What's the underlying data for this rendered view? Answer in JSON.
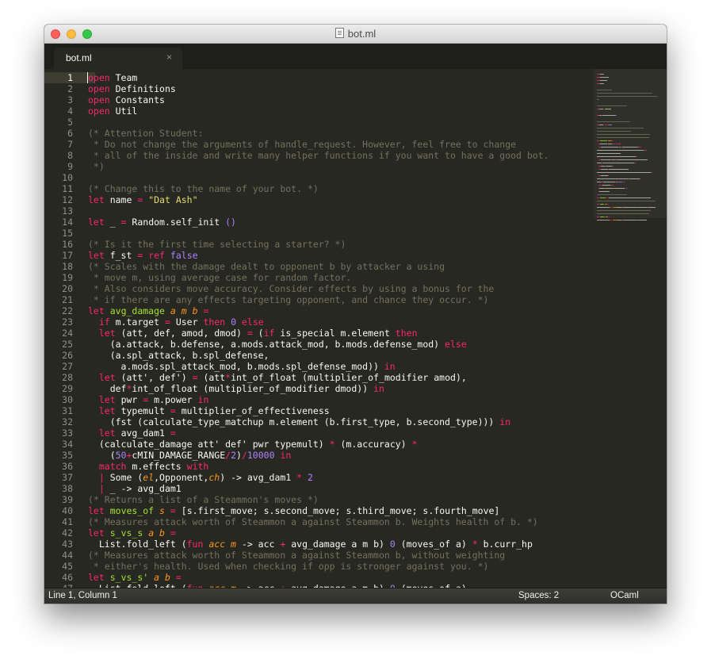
{
  "window": {
    "title": "bot.ml",
    "buttons": [
      "close",
      "minimize",
      "zoom"
    ]
  },
  "tab": {
    "label": "bot.ml",
    "close_glyph": "×"
  },
  "editor": {
    "current_line": 1,
    "lines": [
      [
        [
          "kw",
          "open"
        ],
        [
          "tx",
          " Team"
        ]
      ],
      [
        [
          "kw",
          "open"
        ],
        [
          "tx",
          " Definitions"
        ]
      ],
      [
        [
          "kw",
          "open"
        ],
        [
          "tx",
          " Constants"
        ]
      ],
      [
        [
          "kw",
          "open"
        ],
        [
          "tx",
          " Util"
        ]
      ],
      [],
      [
        [
          "cm",
          "(* Attention Student:"
        ]
      ],
      [
        [
          "cm",
          " * Do not change the arguments of handle_request. However, feel free to change"
        ]
      ],
      [
        [
          "cm",
          " * all of the inside and write many helper functions if you want to have a good bot."
        ]
      ],
      [
        [
          "cm",
          " *)"
        ]
      ],
      [],
      [
        [
          "cm",
          "(* Change this to the name of your bot. *)"
        ]
      ],
      [
        [
          "kw",
          "let"
        ],
        [
          "tx",
          " name "
        ],
        [
          "op",
          "="
        ],
        [
          "tx",
          " "
        ],
        [
          "str",
          "\"Dat Ash\""
        ]
      ],
      [],
      [
        [
          "kw",
          "let"
        ],
        [
          "tx",
          " _ "
        ],
        [
          "op",
          "="
        ],
        [
          "tx",
          " Random.self_init "
        ],
        [
          "num",
          "()"
        ]
      ],
      [],
      [
        [
          "cm",
          "(* Is it the first time selecting a starter? *)"
        ]
      ],
      [
        [
          "kw",
          "let"
        ],
        [
          "tx",
          " f_st "
        ],
        [
          "op",
          "="
        ],
        [
          "tx",
          " "
        ],
        [
          "kw",
          "ref"
        ],
        [
          "tx",
          " "
        ],
        [
          "num",
          "false"
        ]
      ],
      [
        [
          "cm",
          "(* Scales with the damage dealt to opponent b by attacker a using"
        ]
      ],
      [
        [
          "cm",
          " * move m, using average case for random factor."
        ]
      ],
      [
        [
          "cm",
          " * Also considers move accuracy. Consider effects by using a bonus for the"
        ]
      ],
      [
        [
          "cm",
          " * if there are any effects targeting opponent, and chance they occur. *)"
        ]
      ],
      [
        [
          "kw",
          "let"
        ],
        [
          "tx",
          " "
        ],
        [
          "fn",
          "avg_damage"
        ],
        [
          "tx",
          " "
        ],
        [
          "arg",
          "a m b"
        ],
        [
          "tx",
          " "
        ],
        [
          "op",
          "="
        ]
      ],
      [
        [
          "tx",
          "  "
        ],
        [
          "kw",
          "if"
        ],
        [
          "tx",
          " m.target "
        ],
        [
          "op",
          "="
        ],
        [
          "tx",
          " User "
        ],
        [
          "kw",
          "then"
        ],
        [
          "tx",
          " "
        ],
        [
          "num",
          "0"
        ],
        [
          "tx",
          " "
        ],
        [
          "kw",
          "else"
        ]
      ],
      [
        [
          "tx",
          "  "
        ],
        [
          "kw",
          "let"
        ],
        [
          "tx",
          " (att, def, amod, dmod) "
        ],
        [
          "op",
          "="
        ],
        [
          "tx",
          " ("
        ],
        [
          "kw",
          "if"
        ],
        [
          "tx",
          " is_special m.element "
        ],
        [
          "kw",
          "then"
        ]
      ],
      [
        [
          "tx",
          "    (a.attack, b.defense, a.mods.attack_mod, b.mods.defense_mod) "
        ],
        [
          "kw",
          "else"
        ]
      ],
      [
        [
          "tx",
          "    (a.spl_attack, b.spl_defense,"
        ]
      ],
      [
        [
          "tx",
          "      a.mods.spl_attack_mod, b.mods.spl_defense_mod)) "
        ],
        [
          "kw",
          "in"
        ]
      ],
      [
        [
          "tx",
          "  "
        ],
        [
          "kw",
          "let"
        ],
        [
          "tx",
          " (att', def') "
        ],
        [
          "op",
          "="
        ],
        [
          "tx",
          " (att"
        ],
        [
          "op",
          "*"
        ],
        [
          "tx",
          "int_of_float (multiplier_of_modifier amod),"
        ]
      ],
      [
        [
          "tx",
          "    def"
        ],
        [
          "op",
          "*"
        ],
        [
          "tx",
          "int_of_float (multiplier_of_modifier dmod)) "
        ],
        [
          "kw",
          "in"
        ]
      ],
      [
        [
          "tx",
          "  "
        ],
        [
          "kw",
          "let"
        ],
        [
          "tx",
          " pwr "
        ],
        [
          "op",
          "="
        ],
        [
          "tx",
          " m.power "
        ],
        [
          "kw",
          "in"
        ]
      ],
      [
        [
          "tx",
          "  "
        ],
        [
          "kw",
          "let"
        ],
        [
          "tx",
          " typemult "
        ],
        [
          "op",
          "="
        ],
        [
          "tx",
          " multiplier_of_effectiveness"
        ]
      ],
      [
        [
          "tx",
          "    (fst (calculate_type_matchup m.element (b.first_type, b.second_type))) "
        ],
        [
          "kw",
          "in"
        ]
      ],
      [
        [
          "tx",
          "  "
        ],
        [
          "kw",
          "let"
        ],
        [
          "tx",
          " avg_dam1 "
        ],
        [
          "op",
          "="
        ]
      ],
      [
        [
          "tx",
          "  (calculate_damage att' def' pwr typemult) "
        ],
        [
          "op",
          "*"
        ],
        [
          "tx",
          " (m.accuracy) "
        ],
        [
          "op",
          "*"
        ]
      ],
      [
        [
          "tx",
          "    ("
        ],
        [
          "num",
          "50"
        ],
        [
          "op",
          "+"
        ],
        [
          "tx",
          "cMIN_DAMAGE_RANGE"
        ],
        [
          "op",
          "/"
        ],
        [
          "num",
          "2"
        ],
        [
          "tx",
          ")"
        ],
        [
          "op",
          "/"
        ],
        [
          "num",
          "10000"
        ],
        [
          "tx",
          " "
        ],
        [
          "kw",
          "in"
        ]
      ],
      [
        [
          "tx",
          "  "
        ],
        [
          "kw",
          "match"
        ],
        [
          "tx",
          " m.effects "
        ],
        [
          "kw",
          "with"
        ]
      ],
      [
        [
          "tx",
          "  "
        ],
        [
          "op",
          "|"
        ],
        [
          "tx",
          " Some ("
        ],
        [
          "arg",
          "el"
        ],
        [
          "tx",
          ",Opponent,"
        ],
        [
          "arg",
          "ch"
        ],
        [
          "tx",
          ") -> avg_dam1 "
        ],
        [
          "op",
          "*"
        ],
        [
          "tx",
          " "
        ],
        [
          "num",
          "2"
        ]
      ],
      [
        [
          "tx",
          "  "
        ],
        [
          "op",
          "|"
        ],
        [
          "tx",
          " _ -> avg_dam1"
        ]
      ],
      [
        [
          "cm",
          "(* Returns a list of a Steammon's moves *)"
        ]
      ],
      [
        [
          "kw",
          "let"
        ],
        [
          "tx",
          " "
        ],
        [
          "fn",
          "moves_of"
        ],
        [
          "tx",
          " "
        ],
        [
          "arg",
          "s"
        ],
        [
          "tx",
          " "
        ],
        [
          "op",
          "="
        ],
        [
          "tx",
          " [s.first_move; s.second_move; s.third_move; s.fourth_move]"
        ]
      ],
      [
        [
          "cm",
          "(* Measures attack worth of Steammon a against Steammon b. Weights health of b. *)"
        ]
      ],
      [
        [
          "kw",
          "let"
        ],
        [
          "tx",
          " "
        ],
        [
          "fn",
          "s_vs_s"
        ],
        [
          "tx",
          " "
        ],
        [
          "arg",
          "a b"
        ],
        [
          "tx",
          " "
        ],
        [
          "op",
          "="
        ]
      ],
      [
        [
          "tx",
          "  List.fold_left ("
        ],
        [
          "kw",
          "fun"
        ],
        [
          "tx",
          " "
        ],
        [
          "arg",
          "acc m"
        ],
        [
          "tx",
          " -> acc "
        ],
        [
          "op",
          "+"
        ],
        [
          "tx",
          " avg_damage a m b) "
        ],
        [
          "num",
          "0"
        ],
        [
          "tx",
          " (moves_of a) "
        ],
        [
          "op",
          "*"
        ],
        [
          "tx",
          " b.curr_hp"
        ]
      ],
      [
        [
          "cm",
          "(* Measures attack worth of Steammon a against Steammon b, without weighting"
        ]
      ],
      [
        [
          "cm",
          " * either's health. Used when checking if opp is stronger against you. *)"
        ]
      ],
      [
        [
          "kw",
          "let"
        ],
        [
          "tx",
          " "
        ],
        [
          "fn",
          "s_vs_s'"
        ],
        [
          "tx",
          " "
        ],
        [
          "arg",
          "a b"
        ],
        [
          "tx",
          " "
        ],
        [
          "op",
          "="
        ]
      ],
      [
        [
          "tx",
          "  List.fold_left ("
        ],
        [
          "kw",
          "fun"
        ],
        [
          "tx",
          " "
        ],
        [
          "arg",
          "acc m"
        ],
        [
          "tx",
          " -> acc "
        ],
        [
          "op",
          "+"
        ],
        [
          "tx",
          " avg_damage a m b) "
        ],
        [
          "num",
          "0"
        ],
        [
          "tx",
          " (moves_of a)"
        ]
      ]
    ]
  },
  "status": {
    "position": "Line 1, Column 1",
    "indentation": "Spaces: 2",
    "syntax": "OCaml"
  },
  "colors": {
    "background": "#272822",
    "keyword": "#f92672",
    "number": "#ae81ff",
    "string": "#e6db74",
    "comment": "#75715e",
    "function": "#a6e22e",
    "argument": "#fd971f",
    "text": "#f8f8f2"
  }
}
